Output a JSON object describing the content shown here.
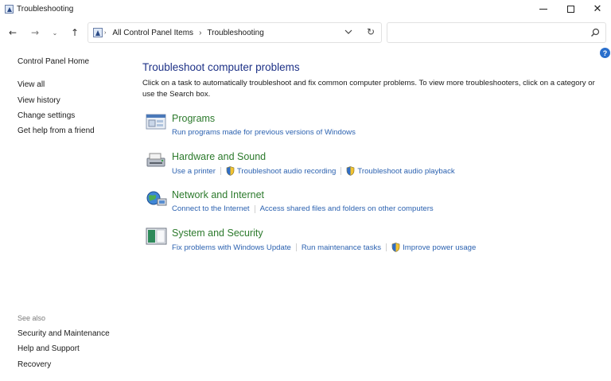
{
  "window": {
    "title": "Troubleshooting",
    "controls": {
      "minimize": "minimize",
      "maximize": "maximize",
      "close": "✕"
    }
  },
  "nav": {
    "back": "←",
    "forward": "→",
    "recent": "⌄",
    "up": "↑",
    "refresh": "↻",
    "dropdown": "⌄"
  },
  "breadcrumb": [
    "All Control Panel Items",
    "Troubleshooting"
  ],
  "breadcrumb_separator": "›",
  "search": {
    "placeholder": "",
    "value": ""
  },
  "help": "?",
  "sidebar": {
    "items": [
      "Control Panel Home",
      "View all",
      "View history",
      "Change settings",
      "Get help from a friend"
    ],
    "see_also_label": "See also",
    "see_also_items": [
      "Security and Maintenance",
      "Help and Support",
      "Recovery"
    ]
  },
  "main": {
    "title": "Troubleshoot computer problems",
    "description": "Click on a task to automatically troubleshoot and fix common computer problems. To view more troubleshooters, click on a category or use the Search box."
  },
  "categories": [
    {
      "title": "Programs",
      "icon": "programs-icon",
      "links": [
        {
          "label": "Run programs made for previous versions of Windows",
          "shield": false
        }
      ]
    },
    {
      "title": "Hardware and Sound",
      "icon": "hardware-sound-icon",
      "links": [
        {
          "label": "Use a printer",
          "shield": false
        },
        {
          "label": "Troubleshoot audio recording",
          "shield": true
        },
        {
          "label": "Troubleshoot audio playback",
          "shield": true
        }
      ]
    },
    {
      "title": "Network and Internet",
      "icon": "network-internet-icon",
      "links": [
        {
          "label": "Connect to the Internet",
          "shield": false
        },
        {
          "label": "Access shared files and folders on other computers",
          "shield": false
        }
      ]
    },
    {
      "title": "System and Security",
      "icon": "system-security-icon",
      "links": [
        {
          "label": "Fix problems with Windows Update",
          "shield": false
        },
        {
          "label": "Run maintenance tasks",
          "shield": false
        },
        {
          "label": "Improve power usage",
          "shield": true
        }
      ]
    }
  ],
  "colors": {
    "title_blue": "#1e3287",
    "category_green": "#2c7a2c",
    "link_blue": "#2c62b0",
    "help_blue": "#2a6fcc"
  }
}
